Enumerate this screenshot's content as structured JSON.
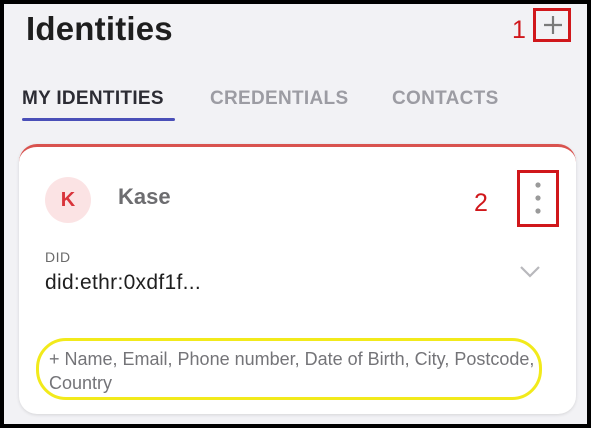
{
  "header": {
    "title": "Identities",
    "annotation_1": "1"
  },
  "tabs": [
    {
      "label": "MY IDENTITIES",
      "active": true
    },
    {
      "label": "CREDENTIALS",
      "active": false
    },
    {
      "label": "CONTACTS",
      "active": false
    }
  ],
  "card": {
    "avatar_initial": "K",
    "name": "Kase",
    "annotation_2": "2",
    "did_label": "DID",
    "did_value": "did:ethr:0xdf1f...",
    "attributes_hint": "+ Name, Email, Phone number, Date of Birth, City, Postcode, Country"
  },
  "icons": {
    "add": "plus-icon",
    "menu": "more-vertical-icon",
    "expand": "chevron-down-icon"
  },
  "colors": {
    "annotation_red": "#d0171b",
    "highlight_yellow": "#f2ea1b",
    "tab_accent": "#4a4fb8",
    "avatar_text": "#d9343b",
    "avatar_bg": "#fbe3e4",
    "card_accent": "#d9534f"
  }
}
